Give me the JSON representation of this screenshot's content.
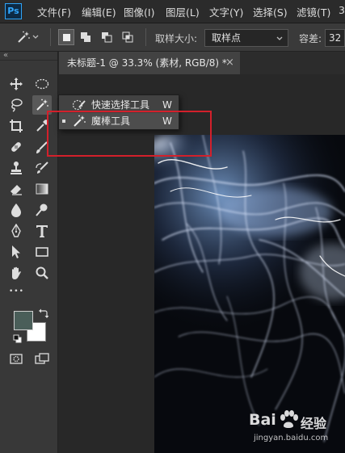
{
  "app": {
    "logo_text": "Ps"
  },
  "menubar": {
    "items": [
      "文件(F)",
      "编辑(E)",
      "图像(I)",
      "图层(L)",
      "文字(Y)",
      "选择(S)",
      "滤镜(T)",
      "3"
    ]
  },
  "options_bar": {
    "sample_size_label": "取样大小:",
    "sample_size_value": "取样点",
    "tolerance_label": "容差:",
    "tolerance_value": "32"
  },
  "document": {
    "tab_title": "未标题-1 @ 33.3% (素材, RGB/8) *",
    "close_glyph": "×"
  },
  "tool_panel": {
    "collapse_glyph": "«",
    "more_glyph": "•••"
  },
  "flyout": {
    "items": [
      {
        "name": "快速选择工具",
        "shortcut": "W",
        "icon": "quick-selection-icon",
        "selected": false
      },
      {
        "name": "魔棒工具",
        "shortcut": "W",
        "icon": "magic-wand-icon",
        "selected": true
      }
    ]
  },
  "colors": {
    "foreground": "#4a5e59",
    "background": "#ffffff",
    "highlight_box": "#d3202b"
  },
  "watermark": {
    "brand_text": "Bai",
    "brand_suffix": "经验",
    "url": "jingyan.baidu.com"
  }
}
